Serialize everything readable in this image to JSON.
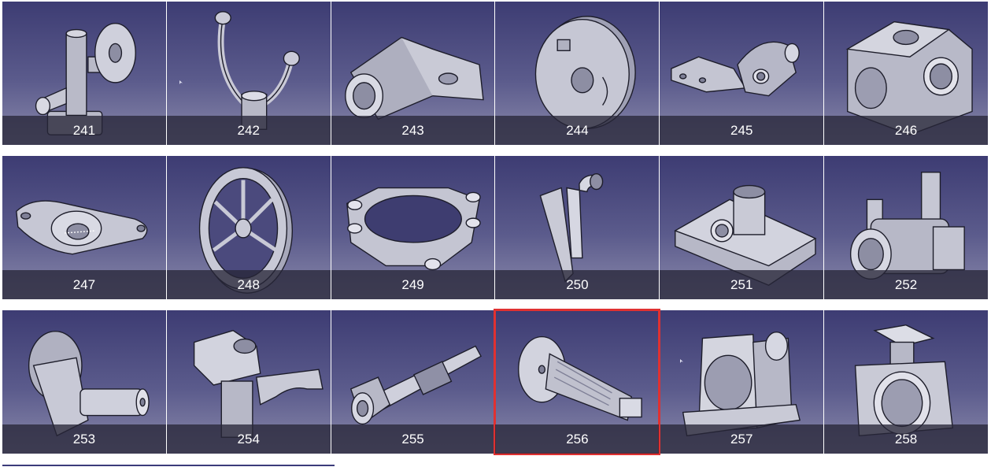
{
  "gallery": {
    "selected": "256",
    "selection_color": "#e03131",
    "items": [
      {
        "label": "241",
        "icon": "pipe-valve-body-icon"
      },
      {
        "label": "242",
        "icon": "curved-fork-icon"
      },
      {
        "label": "243",
        "icon": "bracket-housing-icon"
      },
      {
        "label": "244",
        "icon": "round-flange-disc-icon"
      },
      {
        "label": "245",
        "icon": "linkage-arm-icon"
      },
      {
        "label": "246",
        "icon": "block-housing-icon"
      },
      {
        "label": "247",
        "icon": "rocker-arm-icon"
      },
      {
        "label": "248",
        "icon": "spoked-wheel-icon"
      },
      {
        "label": "249",
        "icon": "ring-bracket-icon"
      },
      {
        "label": "250",
        "icon": "bent-tube-icon"
      },
      {
        "label": "251",
        "icon": "bearing-base-icon"
      },
      {
        "label": "252",
        "icon": "cylinder-bracket-icon"
      },
      {
        "label": "253",
        "icon": "crank-shaft-icon"
      },
      {
        "label": "254",
        "icon": "fork-support-icon"
      },
      {
        "label": "255",
        "icon": "slotted-shaft-icon"
      },
      {
        "label": "256",
        "icon": "splined-shaft-flange-icon"
      },
      {
        "label": "257",
        "icon": "bearing-housing-icon"
      },
      {
        "label": "258",
        "icon": "valve-body-icon"
      }
    ]
  }
}
